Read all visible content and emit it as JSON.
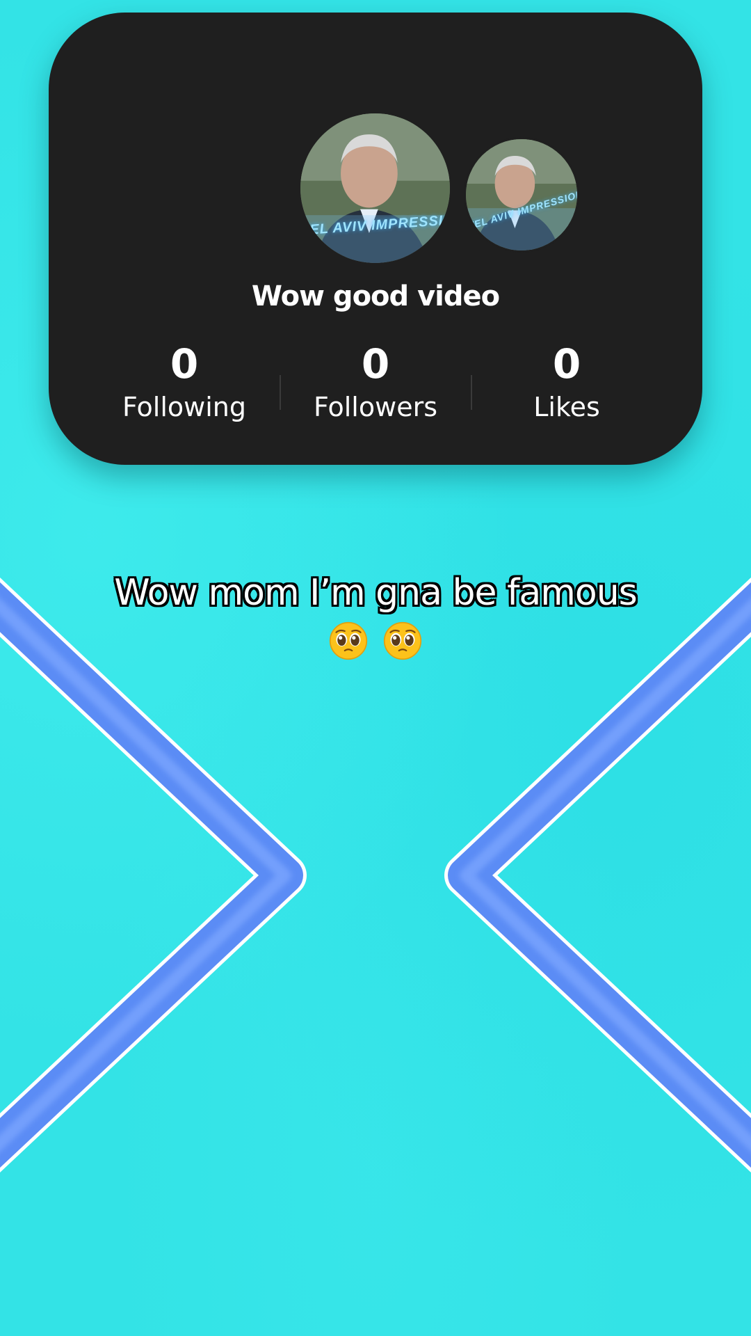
{
  "profile": {
    "name": "Wow good video",
    "avatar_caption": "TEL AVIV IMPRESSIONS",
    "stats": [
      {
        "value": "0",
        "label": "Following"
      },
      {
        "value": "0",
        "label": "Followers"
      },
      {
        "value": "0",
        "label": "Likes"
      }
    ]
  },
  "caption": {
    "text": "Wow mom I’m gna be famous",
    "emoji": [
      "pleading-face-emoji",
      "pleading-face-emoji"
    ]
  },
  "colors": {
    "background": "#33e3e6",
    "card": "#1f1f1f",
    "chevron": "#5b8cf5",
    "chevron_outline": "#ffffff"
  }
}
